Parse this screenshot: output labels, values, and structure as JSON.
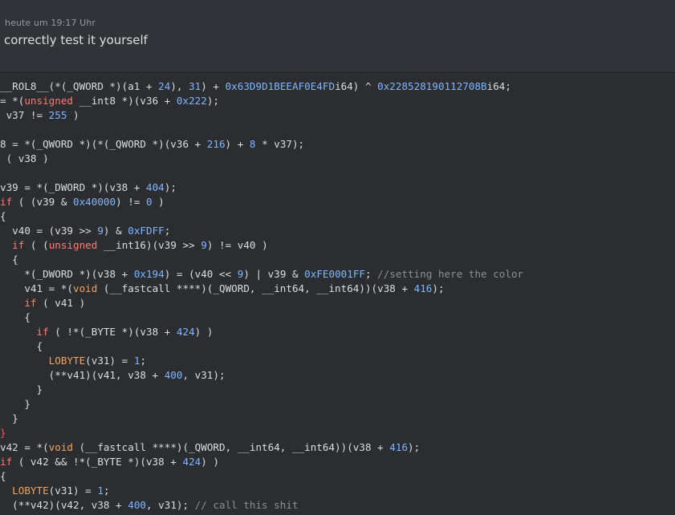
{
  "message": {
    "timestamp": "heute um 19:17 Uhr",
    "text": "correctly test it yourself"
  },
  "code": {
    "lines": [
      [
        [
          "plain",
          "__ROL8__(*(_QWORD *)(a1 + "
        ],
        [
          "num",
          "24"
        ],
        [
          "plain",
          "), "
        ],
        [
          "num",
          "31"
        ],
        [
          "plain",
          ") + "
        ],
        [
          "num",
          "0x63D9D1BEEAF0E4FD"
        ],
        [
          "plain",
          "i64) ^ "
        ],
        [
          "num",
          "0x228528190112708B"
        ],
        [
          "plain",
          "i64;"
        ]
      ],
      [
        [
          "plain",
          "= *("
        ],
        [
          "kw",
          "unsigned"
        ],
        [
          "plain",
          " __int8 *)(v36 + "
        ],
        [
          "num",
          "0x222"
        ],
        [
          "plain",
          ");"
        ]
      ],
      [
        [
          "plain",
          " v37 != "
        ],
        [
          "num",
          "255"
        ],
        [
          "plain",
          " )"
        ]
      ],
      [
        [
          "plain",
          ""
        ]
      ],
      [
        [
          "plain",
          "8 = *(_QWORD *)(*(_QWORD *)(v36 + "
        ],
        [
          "num",
          "216"
        ],
        [
          "plain",
          ") + "
        ],
        [
          "num",
          "8"
        ],
        [
          "plain",
          " * v37);"
        ]
      ],
      [
        [
          "plain",
          " ( v38 )"
        ]
      ],
      [
        [
          "plain",
          ""
        ]
      ],
      [
        [
          "plain",
          "v39 = *(_DWORD *)(v38 + "
        ],
        [
          "num",
          "404"
        ],
        [
          "plain",
          ");"
        ]
      ],
      [
        [
          "kw",
          "if"
        ],
        [
          "plain",
          " ( (v39 & "
        ],
        [
          "num",
          "0x40000"
        ],
        [
          "plain",
          ") != "
        ],
        [
          "num",
          "0"
        ],
        [
          "plain",
          " )"
        ]
      ],
      [
        [
          "plain",
          "{"
        ]
      ],
      [
        [
          "plain",
          "  v40 = (v39 >> "
        ],
        [
          "num",
          "9"
        ],
        [
          "plain",
          ") & "
        ],
        [
          "num",
          "0xFDFF"
        ],
        [
          "plain",
          ";"
        ]
      ],
      [
        [
          "plain",
          "  "
        ],
        [
          "kw",
          "if"
        ],
        [
          "plain",
          " ( ("
        ],
        [
          "kw",
          "unsigned"
        ],
        [
          "plain",
          " __int16)(v39 >> "
        ],
        [
          "num",
          "9"
        ],
        [
          "plain",
          ") != v40 )"
        ]
      ],
      [
        [
          "plain",
          "  {"
        ]
      ],
      [
        [
          "plain",
          "    *(_DWORD *)(v38 + "
        ],
        [
          "num",
          "0x194"
        ],
        [
          "plain",
          ") = (v40 << "
        ],
        [
          "num",
          "9"
        ],
        [
          "plain",
          ") | v39 & "
        ],
        [
          "num",
          "0xFE0001FF"
        ],
        [
          "plain",
          "; "
        ],
        [
          "cm",
          "//setting here the color"
        ]
      ],
      [
        [
          "plain",
          "    v41 = *("
        ],
        [
          "kw2",
          "void"
        ],
        [
          "plain",
          " (__fastcall ****)(_QWORD, __int64, __int64))(v38 + "
        ],
        [
          "num",
          "416"
        ],
        [
          "plain",
          ");"
        ]
      ],
      [
        [
          "plain",
          "    "
        ],
        [
          "kw",
          "if"
        ],
        [
          "plain",
          " ( v41 )"
        ]
      ],
      [
        [
          "plain",
          "    {"
        ]
      ],
      [
        [
          "plain",
          "      "
        ],
        [
          "kw",
          "if"
        ],
        [
          "plain",
          " ( !*(_BYTE *)(v38 + "
        ],
        [
          "num",
          "424"
        ],
        [
          "plain",
          ") )"
        ]
      ],
      [
        [
          "plain",
          "      {"
        ]
      ],
      [
        [
          "plain",
          "        "
        ],
        [
          "kw2",
          "LOBYTE"
        ],
        [
          "plain",
          "(v31) = "
        ],
        [
          "num",
          "1"
        ],
        [
          "plain",
          ";"
        ]
      ],
      [
        [
          "plain",
          "        (**v41)(v41, v38 + "
        ],
        [
          "num",
          "400"
        ],
        [
          "plain",
          ", v31);"
        ]
      ],
      [
        [
          "plain",
          "      }"
        ]
      ],
      [
        [
          "plain",
          "    }"
        ]
      ],
      [
        [
          "plain",
          "  }"
        ]
      ],
      [
        [
          "red",
          "}"
        ]
      ],
      [
        [
          "plain",
          "v42 = *("
        ],
        [
          "kw2",
          "void"
        ],
        [
          "plain",
          " (__fastcall ****)(_QWORD, __int64, __int64))(v38 + "
        ],
        [
          "num",
          "416"
        ],
        [
          "plain",
          ");"
        ]
      ],
      [
        [
          "kw",
          "if"
        ],
        [
          "plain",
          " ( v42 && !*(_BYTE *)(v38 + "
        ],
        [
          "num",
          "424"
        ],
        [
          "plain",
          ") )"
        ]
      ],
      [
        [
          "plain",
          "{"
        ]
      ],
      [
        [
          "plain",
          "  "
        ],
        [
          "kw2",
          "LOBYTE"
        ],
        [
          "plain",
          "(v31) = "
        ],
        [
          "num",
          "1"
        ],
        [
          "plain",
          ";"
        ]
      ],
      [
        [
          "plain",
          "  (**v42)(v42, v38 + "
        ],
        [
          "num",
          "400"
        ],
        [
          "plain",
          ", v31); "
        ],
        [
          "cm",
          "// call this shit"
        ]
      ]
    ]
  }
}
